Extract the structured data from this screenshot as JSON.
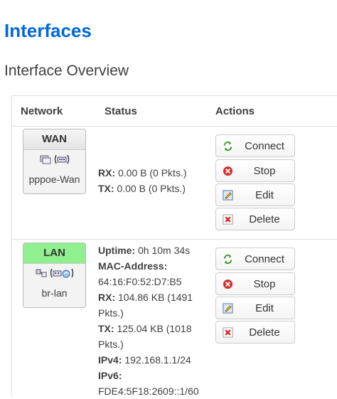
{
  "page_title": "Interfaces",
  "section_title": "Interface Overview",
  "table": {
    "headers": {
      "network": "Network",
      "status": "Status",
      "actions": "Actions"
    }
  },
  "interfaces": [
    {
      "name": "WAN",
      "device": "pppoe-Wan",
      "status": {
        "rx_label": "RX",
        "rx_value": "0.00 B (0 Pkts.)",
        "tx_label": "TX",
        "tx_value": "0.00 B (0 Pkts.)"
      },
      "actions": {
        "connect": "Connect",
        "stop": "Stop",
        "edit": "Edit",
        "delete": "Delete"
      }
    },
    {
      "name": "LAN",
      "device": "br-lan",
      "status": {
        "uptime_label": "Uptime",
        "uptime_value": "0h 10m 34s",
        "mac_label": "MAC-Address",
        "mac_value": "64:16:F0:52:D7:B5",
        "rx_label": "RX",
        "rx_value_line1": "104.86 KB (1491",
        "rx_value_line2": "Pkts.)",
        "tx_label": "TX",
        "tx_value_line1": "125.04 KB (1018",
        "tx_value_line2": "Pkts.)",
        "ipv4_label": "IPv4",
        "ipv4_value": "192.168.1.1/24",
        "ipv6_label": "IPv6",
        "ipv6_value": "FDE4:5F18:2609::1/60"
      },
      "actions": {
        "connect": "Connect",
        "stop": "Stop",
        "edit": "Edit",
        "delete": "Delete"
      }
    }
  ],
  "colors": {
    "title": "#0069d6",
    "wan_header": "#e6e6e6",
    "lan_header": "#90f090",
    "connect_icon": "#3a9a2a",
    "stop_icon": "#d43030",
    "delete_icon": "#d42020"
  },
  "icons": {
    "connect": "refresh-arrows-icon",
    "stop": "stop-circle-icon",
    "edit": "edit-pencil-icon",
    "delete": "delete-x-icon",
    "network": "network-port-icon"
  }
}
